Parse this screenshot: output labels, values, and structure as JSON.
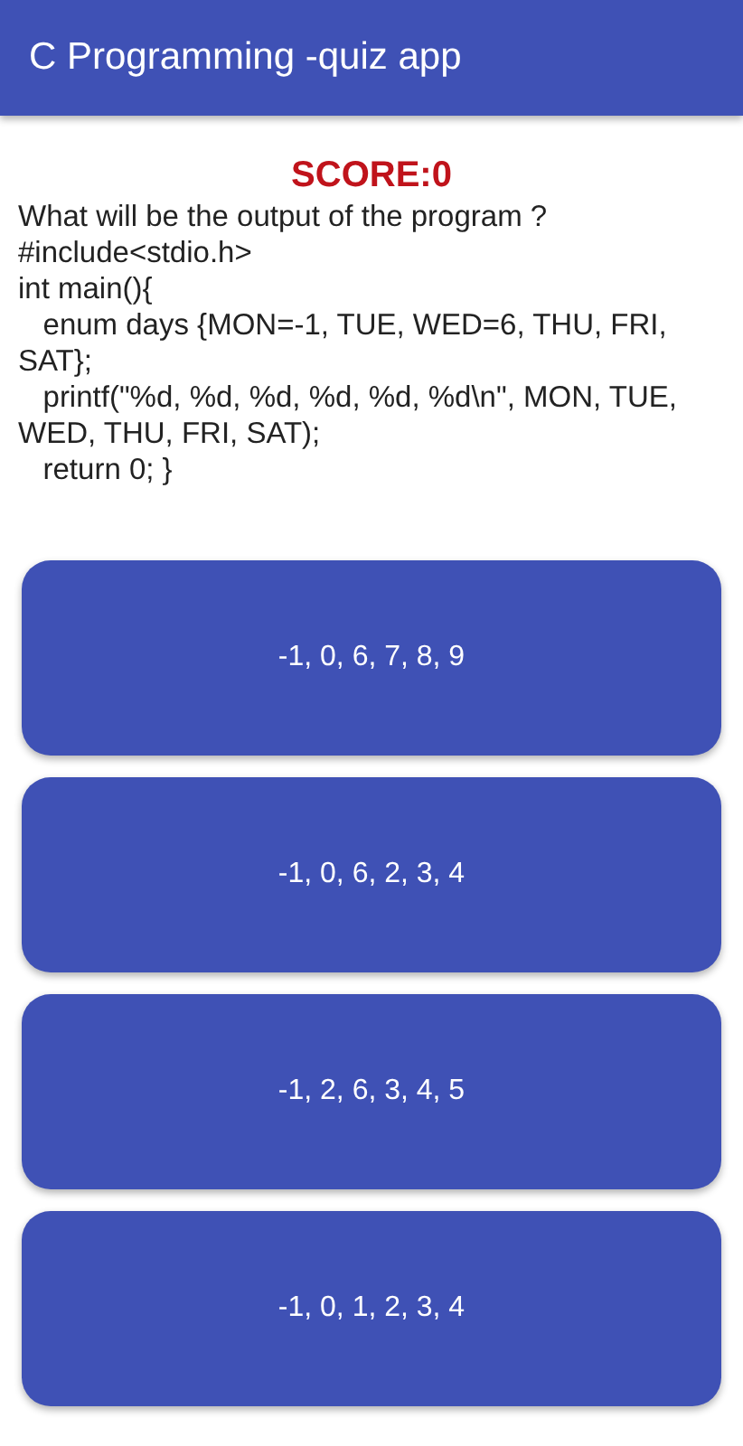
{
  "app_bar": {
    "title": "C Programming -quiz app"
  },
  "score": "SCORE:0",
  "question": "What will be the output of the program ?\n#include<stdio.h>\nint main(){\n   enum days {MON=-1, TUE, WED=6, THU, FRI, SAT};\n   printf(\"%d, %d, %d, %d, %d, %d\\n\", MON, TUE, WED, THU, FRI, SAT);\n   return 0; }",
  "options": [
    "-1, 0, 6, 7, 8, 9",
    "-1, 0, 6, 2, 3, 4",
    "-1, 2, 6, 3, 4, 5",
    "-1, 0, 1, 2, 3, 4"
  ]
}
